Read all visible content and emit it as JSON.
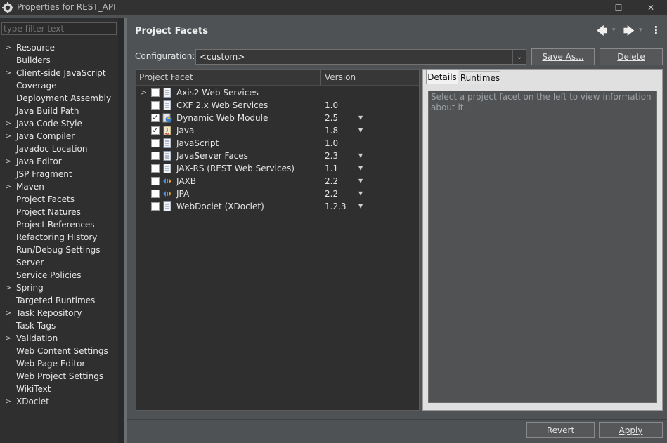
{
  "window": {
    "title": "Properties for REST_API",
    "minimize_glyph": "—",
    "maximize_glyph": "☐",
    "close_glyph": "✕"
  },
  "filter": {
    "placeholder": "type filter text"
  },
  "sidebar": {
    "items": [
      {
        "label": "Resource",
        "expandable": true
      },
      {
        "label": "Builders",
        "expandable": false
      },
      {
        "label": "Client-side JavaScript",
        "expandable": true
      },
      {
        "label": "Coverage",
        "expandable": false
      },
      {
        "label": "Deployment Assembly",
        "expandable": false
      },
      {
        "label": "Java Build Path",
        "expandable": false
      },
      {
        "label": "Java Code Style",
        "expandable": true
      },
      {
        "label": "Java Compiler",
        "expandable": true
      },
      {
        "label": "Javadoc Location",
        "expandable": false
      },
      {
        "label": "Java Editor",
        "expandable": true
      },
      {
        "label": "JSP Fragment",
        "expandable": false
      },
      {
        "label": "Maven",
        "expandable": true
      },
      {
        "label": "Project Facets",
        "expandable": false
      },
      {
        "label": "Project Natures",
        "expandable": false
      },
      {
        "label": "Project References",
        "expandable": false
      },
      {
        "label": "Refactoring History",
        "expandable": false
      },
      {
        "label": "Run/Debug Settings",
        "expandable": false
      },
      {
        "label": "Server",
        "expandable": false
      },
      {
        "label": "Service Policies",
        "expandable": false
      },
      {
        "label": "Spring",
        "expandable": true
      },
      {
        "label": "Targeted Runtimes",
        "expandable": false
      },
      {
        "label": "Task Repository",
        "expandable": true
      },
      {
        "label": "Task Tags",
        "expandable": false
      },
      {
        "label": "Validation",
        "expandable": true
      },
      {
        "label": "Web Content Settings",
        "expandable": false
      },
      {
        "label": "Web Page Editor",
        "expandable": false
      },
      {
        "label": "Web Project Settings",
        "expandable": false
      },
      {
        "label": "WikiText",
        "expandable": false
      },
      {
        "label": "XDoclet",
        "expandable": true
      }
    ]
  },
  "header": {
    "title": "Project Facets",
    "back_glyph": "🡄",
    "forward_glyph": "🡆",
    "dropdown_glyph": "▾",
    "menu_glyph": "⋮"
  },
  "configuration": {
    "label": "Configuration:",
    "value": "<custom>",
    "arrow_glyph": "⌄",
    "save_as_label": "Save As...",
    "delete_label": "Delete"
  },
  "facets": {
    "columns": {
      "facet": "Project Facet",
      "version": "Version"
    },
    "rows": [
      {
        "name": "Axis2 Web Services",
        "version": "",
        "checked": false,
        "expander": true,
        "icon": "page-icon",
        "has_dropdown": false
      },
      {
        "name": "CXF 2.x Web Services",
        "version": "1.0",
        "checked": false,
        "expander": false,
        "icon": "page-icon",
        "has_dropdown": false
      },
      {
        "name": "Dynamic Web Module",
        "version": "2.5",
        "checked": true,
        "expander": false,
        "icon": "web-module-icon",
        "has_dropdown": true
      },
      {
        "name": "Java",
        "version": "1.8",
        "checked": true,
        "expander": false,
        "icon": "java-icon",
        "has_dropdown": true
      },
      {
        "name": "JavaScript",
        "version": "1.0",
        "checked": false,
        "expander": false,
        "icon": "page-icon",
        "has_dropdown": false
      },
      {
        "name": "JavaServer Faces",
        "version": "2.3",
        "checked": false,
        "expander": false,
        "icon": "page-icon",
        "has_dropdown": true
      },
      {
        "name": "JAX-RS (REST Web Services)",
        "version": "1.1",
        "checked": false,
        "expander": false,
        "icon": "page-icon",
        "has_dropdown": true
      },
      {
        "name": "JAXB",
        "version": "2.2",
        "checked": false,
        "expander": false,
        "icon": "xml-icon",
        "has_dropdown": true
      },
      {
        "name": "JPA",
        "version": "2.2",
        "checked": false,
        "expander": false,
        "icon": "xml-icon",
        "has_dropdown": true
      },
      {
        "name": "WebDoclet (XDoclet)",
        "version": "1.2.3",
        "checked": false,
        "expander": false,
        "icon": "page-icon",
        "has_dropdown": true
      }
    ]
  },
  "details": {
    "tab_details": "Details",
    "tab_runtimes": "Runtimes",
    "message": "Select a project facet on the left to view information about it."
  },
  "footer": {
    "revert_label": "Revert",
    "apply_label": "Apply"
  }
}
